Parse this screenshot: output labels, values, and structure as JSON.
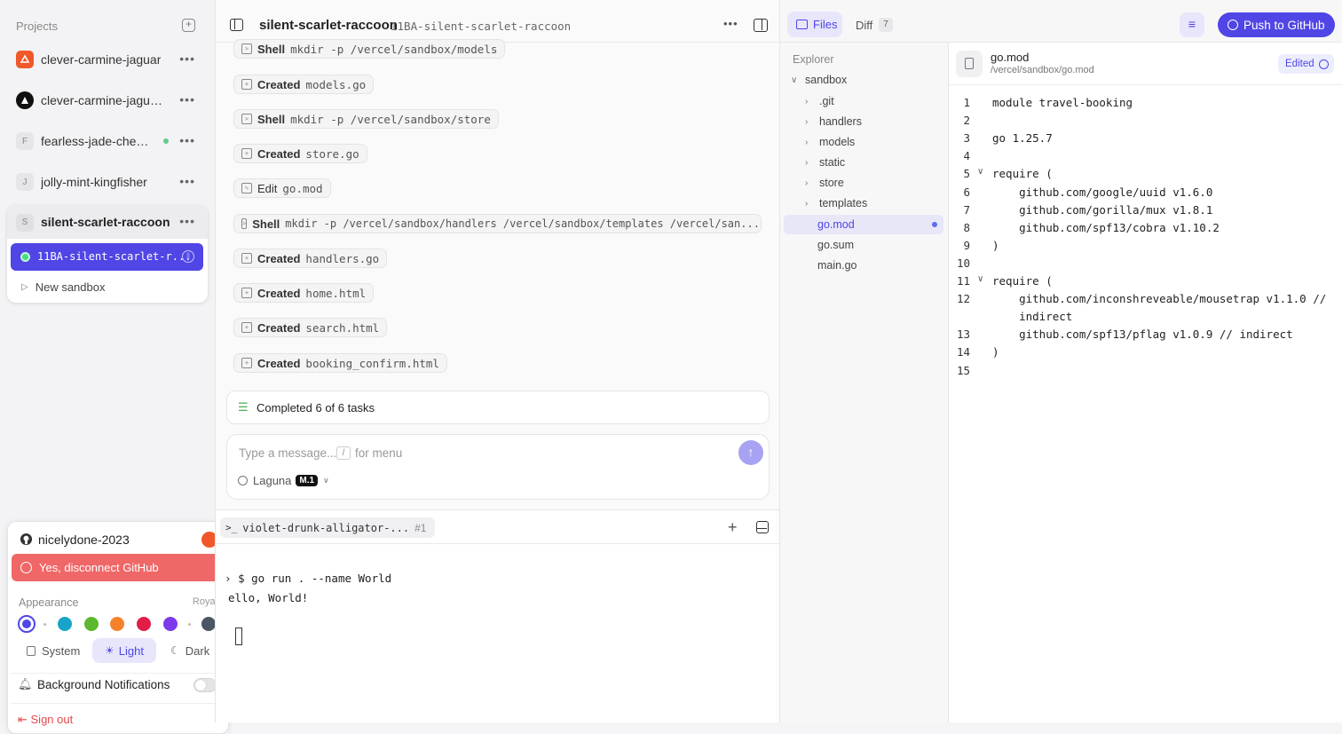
{
  "sidebar": {
    "header": "Projects",
    "projects": [
      {
        "name": "clever-carmine-jaguar",
        "avatar": ""
      },
      {
        "name": "clever-carmine-jaguar-...",
        "avatar": ""
      },
      {
        "name": "fearless-jade-cheet...",
        "avatar": "F"
      },
      {
        "name": "jolly-mint-kingfisher",
        "avatar": "J"
      },
      {
        "name": "silent-scarlet-raccoon",
        "avatar": "S"
      }
    ],
    "active_sandbox": "11BA-silent-scarlet-r...",
    "new_sandbox": "New sandbox"
  },
  "account_menu": {
    "username": "nicelydone-2023",
    "disconnect": "Yes, disconnect GitHub",
    "appearance_label": "Appearance",
    "theme_name": "Royal",
    "swatches": [
      "#4f46e5",
      "#1aa3c9",
      "#5cb82f",
      "#f5822a",
      "#e11d48",
      "#7c3aed",
      "#4b5563"
    ],
    "mode_system": "System",
    "mode_light": "Light",
    "mode_dark": "Dark",
    "notifications": "Background Notifications",
    "sign_out": "Sign out"
  },
  "center": {
    "title": "silent-scarlet-raccoon",
    "subtitle": "11BA-silent-scarlet-raccoon",
    "steps": [
      {
        "verb": "Shell",
        "arg": "mkdir -p /vercel/sandbox/models"
      },
      {
        "verb": "Created",
        "arg": "models.go"
      },
      {
        "verb": "Shell",
        "arg": "mkdir -p /vercel/sandbox/store"
      },
      {
        "verb": "Created",
        "arg": "store.go"
      },
      {
        "verb": "Edit",
        "arg": "go.mod"
      },
      {
        "verb": "Shell",
        "arg": "mkdir -p /vercel/sandbox/handlers /vercel/sandbox/templates /vercel/san..."
      },
      {
        "verb": "Created",
        "arg": "handlers.go"
      },
      {
        "verb": "Created",
        "arg": "home.html"
      },
      {
        "verb": "Created",
        "arg": "search.html"
      },
      {
        "verb": "Created",
        "arg": "booking_confirm.html"
      }
    ],
    "tasks": "Completed 6 of 6 tasks",
    "input_placeholder": "Type a message...",
    "input_key": "/",
    "input_hint": "for menu",
    "model": "Laguna",
    "model_badge": "M.1"
  },
  "terminal": {
    "tab": "violet-drunk-alligator-...",
    "tab_num": "#1",
    "line1": "$ go run . --name World",
    "line2": "ello, World!"
  },
  "right": {
    "files_tab": "Files",
    "diff_tab": "Diff",
    "diff_count": "7",
    "push": "Push to GitHub",
    "explorer": "Explorer",
    "root": "sandbox",
    "items": [
      ".git",
      "handlers",
      "models",
      "static",
      "store",
      "templates",
      "go.mod",
      "go.sum",
      "main.go"
    ],
    "file_name": "go.mod",
    "file_path": "/vercel/sandbox/go.mod",
    "edited": "Edited",
    "code": [
      "module travel-booking",
      "",
      "go 1.25.7",
      "",
      "require (",
      "    github.com/google/uuid v1.6.0",
      "    github.com/gorilla/mux v1.8.1",
      "    github.com/spf13/cobra v1.10.2",
      ")",
      "",
      "require (",
      "    github.com/inconshreveable/mousetrap v1.1.0 //",
      "    indirect",
      "    github.com/spf13/pflag v1.0.9 // indirect",
      ")",
      ""
    ],
    "line_numbers": [
      "1",
      "2",
      "3",
      "4",
      "5",
      "6",
      "7",
      "8",
      "9",
      "10",
      "11",
      "12",
      "",
      "13",
      "14",
      "15"
    ]
  }
}
